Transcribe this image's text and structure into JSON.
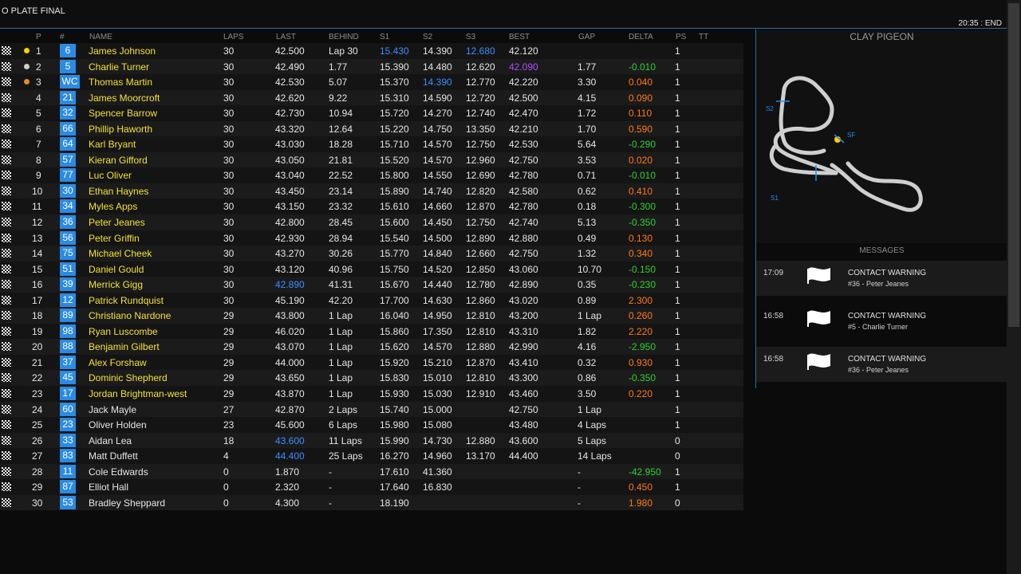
{
  "header": {
    "event_title": "O PLATE FINAL",
    "clock": "20:35 : END"
  },
  "table": {
    "columns": {
      "p": "P",
      "num": "#",
      "name": "NAME",
      "laps": "LAPS",
      "last": "LAST",
      "behind": "BEHIND",
      "s1": "S1",
      "s2": "S2",
      "s3": "S3",
      "best": "BEST",
      "gap": "GAP",
      "delta": "DELTA",
      "ps": "PS",
      "tt": "TT"
    },
    "rows": [
      {
        "pos": "1",
        "num": "6",
        "name": "James Johnson",
        "laps": "30",
        "last": "42.500",
        "behind": "Lap 30",
        "s1": "15.430",
        "s2": "14.390",
        "s3": "12.680",
        "best": "42.120",
        "gap": "",
        "delta": "",
        "ps": "1",
        "medal": "gold",
        "s1c": "blue",
        "s3c": "blue"
      },
      {
        "pos": "2",
        "num": "5",
        "name": "Charlie Turner",
        "laps": "30",
        "last": "42.490",
        "behind": "1.77",
        "s1": "15.390",
        "s2": "14.480",
        "s3": "12.620",
        "best": "42.090",
        "gap": "1.77",
        "delta": "-0.010",
        "ps": "1",
        "medal": "silver",
        "bestc": "purple",
        "dc": "green"
      },
      {
        "pos": "3",
        "num": "WC",
        "name": "Thomas Martin",
        "laps": "30",
        "last": "42.530",
        "behind": "5.07",
        "s1": "15.370",
        "s2": "14.390",
        "s3": "12.770",
        "best": "42.220",
        "gap": "3.30",
        "delta": "0.040",
        "ps": "1",
        "medal": "bronze",
        "s2c": "blue",
        "dc": "orange"
      },
      {
        "pos": "4",
        "num": "21",
        "name": "James Moorcroft",
        "laps": "30",
        "last": "42.620",
        "behind": "9.22",
        "s1": "15.310",
        "s2": "14.590",
        "s3": "12.720",
        "best": "42.500",
        "gap": "4.15",
        "delta": "0.090",
        "ps": "1",
        "dc": "orange"
      },
      {
        "pos": "5",
        "num": "32",
        "name": "Spencer Barrow",
        "laps": "30",
        "last": "42.730",
        "behind": "10.94",
        "s1": "15.720",
        "s2": "14.270",
        "s3": "12.740",
        "best": "42.470",
        "gap": "1.72",
        "delta": "0.110",
        "ps": "1",
        "dc": "orange"
      },
      {
        "pos": "6",
        "num": "66",
        "name": "Phillip Haworth",
        "laps": "30",
        "last": "43.320",
        "behind": "12.64",
        "s1": "15.220",
        "s2": "14.750",
        "s3": "13.350",
        "best": "42.210",
        "gap": "1.70",
        "delta": "0.590",
        "ps": "1",
        "dc": "orange"
      },
      {
        "pos": "7",
        "num": "64",
        "name": "Karl Bryant",
        "laps": "30",
        "last": "43.030",
        "behind": "18.28",
        "s1": "15.710",
        "s2": "14.570",
        "s3": "12.750",
        "best": "42.530",
        "gap": "5.64",
        "delta": "-0.290",
        "ps": "1",
        "dc": "green"
      },
      {
        "pos": "8",
        "num": "57",
        "name": "Kieran Gifford",
        "laps": "30",
        "last": "43.050",
        "behind": "21.81",
        "s1": "15.520",
        "s2": "14.570",
        "s3": "12.960",
        "best": "42.750",
        "gap": "3.53",
        "delta": "0.020",
        "ps": "1",
        "dc": "orange"
      },
      {
        "pos": "9",
        "num": "77",
        "name": "Luc Oliver",
        "laps": "30",
        "last": "43.040",
        "behind": "22.52",
        "s1": "15.800",
        "s2": "14.550",
        "s3": "12.690",
        "best": "42.780",
        "gap": "0.71",
        "delta": "-0.010",
        "ps": "1",
        "dc": "green"
      },
      {
        "pos": "10",
        "num": "30",
        "name": "Ethan Haynes",
        "laps": "30",
        "last": "43.450",
        "behind": "23.14",
        "s1": "15.890",
        "s2": "14.740",
        "s3": "12.820",
        "best": "42.580",
        "gap": "0.62",
        "delta": "0.410",
        "ps": "1",
        "dc": "orange"
      },
      {
        "pos": "11",
        "num": "34",
        "name": "Myles Apps",
        "laps": "30",
        "last": "43.150",
        "behind": "23.32",
        "s1": "15.610",
        "s2": "14.660",
        "s3": "12.870",
        "best": "42.780",
        "gap": "0.18",
        "delta": "-0.300",
        "ps": "1",
        "dc": "green"
      },
      {
        "pos": "12",
        "num": "36",
        "name": "Peter Jeanes",
        "laps": "30",
        "last": "42.800",
        "behind": "28.45",
        "s1": "15.600",
        "s2": "14.450",
        "s3": "12.750",
        "best": "42.740",
        "gap": "5.13",
        "delta": "-0.350",
        "ps": "1",
        "dc": "green"
      },
      {
        "pos": "13",
        "num": "56",
        "name": "Peter Griffin",
        "laps": "30",
        "last": "42.930",
        "behind": "28.94",
        "s1": "15.540",
        "s2": "14.500",
        "s3": "12.890",
        "best": "42.880",
        "gap": "0.49",
        "delta": "0.130",
        "ps": "1",
        "dc": "orange"
      },
      {
        "pos": "14",
        "num": "75",
        "name": "Michael Cheek",
        "laps": "30",
        "last": "43.270",
        "behind": "30.26",
        "s1": "15.770",
        "s2": "14.840",
        "s3": "12.660",
        "best": "42.750",
        "gap": "1.32",
        "delta": "0.340",
        "ps": "1",
        "dc": "orange"
      },
      {
        "pos": "15",
        "num": "51",
        "name": "Daniel Gould",
        "laps": "30",
        "last": "43.120",
        "behind": "40.96",
        "s1": "15.750",
        "s2": "14.520",
        "s3": "12.850",
        "best": "43.060",
        "gap": "10.70",
        "delta": "-0.150",
        "ps": "1",
        "dc": "green"
      },
      {
        "pos": "16",
        "num": "39",
        "name": "Merrick Gigg",
        "laps": "30",
        "last": "42.890",
        "behind": "41.31",
        "s1": "15.670",
        "s2": "14.440",
        "s3": "12.780",
        "best": "42.890",
        "gap": "0.35",
        "delta": "-0.230",
        "ps": "1",
        "lastc": "blue",
        "dc": "green"
      },
      {
        "pos": "17",
        "num": "12",
        "name": "Patrick Rundquist",
        "laps": "30",
        "last": "45.190",
        "behind": "42.20",
        "s1": "17.700",
        "s2": "14.630",
        "s3": "12.860",
        "best": "43.020",
        "gap": "0.89",
        "delta": "2.300",
        "ps": "1",
        "dc": "orange"
      },
      {
        "pos": "18",
        "num": "89",
        "name": "Christiano Nardone",
        "laps": "29",
        "last": "43.800",
        "behind": "1 Lap",
        "s1": "16.040",
        "s2": "14.950",
        "s3": "12.810",
        "best": "43.200",
        "gap": "1 Lap",
        "delta": "0.260",
        "ps": "1",
        "dc": "orange"
      },
      {
        "pos": "19",
        "num": "98",
        "name": "Ryan Luscombe",
        "laps": "29",
        "last": "46.020",
        "behind": "1 Lap",
        "s1": "15.860",
        "s2": "17.350",
        "s3": "12.810",
        "best": "43.310",
        "gap": "1.82",
        "delta": "2.220",
        "ps": "1",
        "dc": "orange"
      },
      {
        "pos": "20",
        "num": "88",
        "name": "Benjamin Gilbert",
        "laps": "29",
        "last": "43.070",
        "behind": "1 Lap",
        "s1": "15.620",
        "s2": "14.570",
        "s3": "12.880",
        "best": "42.990",
        "gap": "4.16",
        "delta": "-2.950",
        "ps": "1",
        "dc": "green"
      },
      {
        "pos": "21",
        "num": "37",
        "name": "Alex Forshaw",
        "laps": "29",
        "last": "44.000",
        "behind": "1 Lap",
        "s1": "15.920",
        "s2": "15.210",
        "s3": "12.870",
        "best": "43.410",
        "gap": "0.32",
        "delta": "0.930",
        "ps": "1",
        "dc": "orange"
      },
      {
        "pos": "22",
        "num": "45",
        "name": "Dominic Shepherd",
        "laps": "29",
        "last": "43.650",
        "behind": "1 Lap",
        "s1": "15.830",
        "s2": "15.010",
        "s3": "12.810",
        "best": "43.300",
        "gap": "0.86",
        "delta": "-0.350",
        "ps": "1",
        "dc": "green"
      },
      {
        "pos": "23",
        "num": "17",
        "name": "Jordan Brightman-west",
        "laps": "29",
        "last": "43.870",
        "behind": "1 Lap",
        "s1": "15.930",
        "s2": "15.030",
        "s3": "12.910",
        "best": "43.460",
        "gap": "3.50",
        "delta": "0.220",
        "ps": "1",
        "dc": "orange"
      },
      {
        "pos": "24",
        "num": "60",
        "name": "Jack Mayle",
        "laps": "27",
        "last": "42.870",
        "behind": "2 Laps",
        "s1": "15.740",
        "s2": "15.000",
        "s3": "",
        "best": "42.750",
        "gap": "1 Lap",
        "delta": "",
        "ps": "1",
        "nc": "white"
      },
      {
        "pos": "25",
        "num": "23",
        "name": "Oliver Holden",
        "laps": "23",
        "last": "45.600",
        "behind": "6 Laps",
        "s1": "15.980",
        "s2": "15.080",
        "s3": "",
        "best": "43.480",
        "gap": "4 Laps",
        "delta": "",
        "ps": "1",
        "nc": "white"
      },
      {
        "pos": "26",
        "num": "33",
        "name": "Aidan Lea",
        "laps": "18",
        "last": "43.600",
        "behind": "11 Laps",
        "s1": "15.990",
        "s2": "14.730",
        "s3": "12.880",
        "best": "43.600",
        "gap": "5 Laps",
        "delta": "",
        "ps": "0",
        "nc": "white",
        "lastc": "blue"
      },
      {
        "pos": "27",
        "num": "83",
        "name": "Matt Duffett",
        "laps": "4",
        "last": "44.400",
        "behind": "25 Laps",
        "s1": "16.270",
        "s2": "14.960",
        "s3": "13.170",
        "best": "44.400",
        "gap": "14 Laps",
        "delta": "",
        "ps": "0",
        "nc": "white",
        "lastc": "blue"
      },
      {
        "pos": "28",
        "num": "11",
        "name": "Cole Edwards",
        "laps": "0",
        "last": "1.870",
        "behind": "-",
        "s1": "17.610",
        "s2": "41.360",
        "s3": "",
        "best": "",
        "gap": "-",
        "delta": "-42.950",
        "ps": "1",
        "nc": "white",
        "dc": "green"
      },
      {
        "pos": "29",
        "num": "87",
        "name": "Elliot Hall",
        "laps": "0",
        "last": "2.320",
        "behind": "-",
        "s1": "17.640",
        "s2": "16.830",
        "s3": "",
        "best": "",
        "gap": "-",
        "delta": "0.450",
        "ps": "1",
        "nc": "white",
        "dc": "orange"
      },
      {
        "pos": "30",
        "num": "53",
        "name": "Bradley Sheppard",
        "laps": "0",
        "last": "4.300",
        "behind": "-",
        "s1": "18.190",
        "s2": "",
        "s3": "",
        "best": "",
        "gap": "-",
        "delta": "1.980",
        "ps": "0",
        "nc": "white",
        "dc": "orange"
      }
    ]
  },
  "track": {
    "name": "CLAY PIGEON",
    "labels": {
      "s1": "S1",
      "s2": "S2",
      "sf": "SF"
    }
  },
  "messages": {
    "header": "MESSAGES",
    "items": [
      {
        "time": "17:09",
        "title": "CONTACT WARNING",
        "detail": "#36 - Peter Jeanes"
      },
      {
        "time": "16:58",
        "title": "CONTACT WARNING",
        "detail": "#5 - Charlie Turner"
      },
      {
        "time": "16:58",
        "title": "CONTACT WARNING",
        "detail": "#36 - Peter Jeanes"
      }
    ]
  },
  "colors": {
    "accent": "#2a6fb0",
    "badge": "#2b8be2",
    "name_yellow": "#f2e23a",
    "white": "#e6e6e6",
    "blue": "#3b8fff",
    "purple": "#b04cff",
    "green": "#2fd12f",
    "orange": "#ff7a1a",
    "gold": "#ffcc00",
    "silver": "#cfcfcf",
    "bronze": "#e08a2c"
  }
}
